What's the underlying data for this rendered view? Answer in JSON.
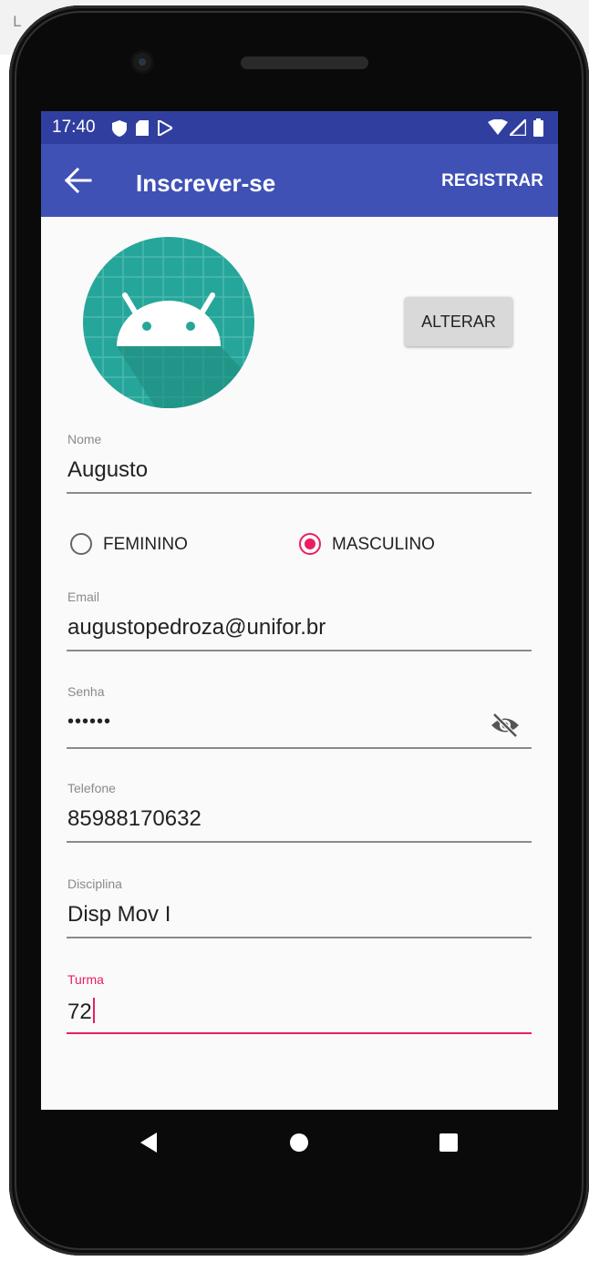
{
  "status_bar": {
    "time": "17:40"
  },
  "app_bar": {
    "title": "Inscrever-se",
    "action_label": "REGISTRAR"
  },
  "profile": {
    "change_button": "ALTERAR"
  },
  "form": {
    "nome": {
      "label": "Nome",
      "value": "Augusto"
    },
    "gender": {
      "options": [
        "FEMININO",
        "MASCULINO"
      ],
      "selected": "MASCULINO"
    },
    "email": {
      "label": "Email",
      "value": "augustopedroza@unifor.br"
    },
    "senha": {
      "label": "Senha",
      "value": "••••••"
    },
    "telefone": {
      "label": "Telefone",
      "value": "85988170632"
    },
    "disciplina": {
      "label": "Disciplina",
      "value": "Disp Mov I"
    },
    "turma": {
      "label": "Turma",
      "value": "72"
    }
  },
  "colors": {
    "primary": "#3f51b5",
    "primary_dark": "#303f9f",
    "accent": "#e91e63",
    "avatar_bg": "#26a69a"
  },
  "icons": [
    "back-arrow-icon",
    "visibility-off-icon",
    "nav-back-icon",
    "nav-home-icon",
    "nav-recents-icon"
  ]
}
